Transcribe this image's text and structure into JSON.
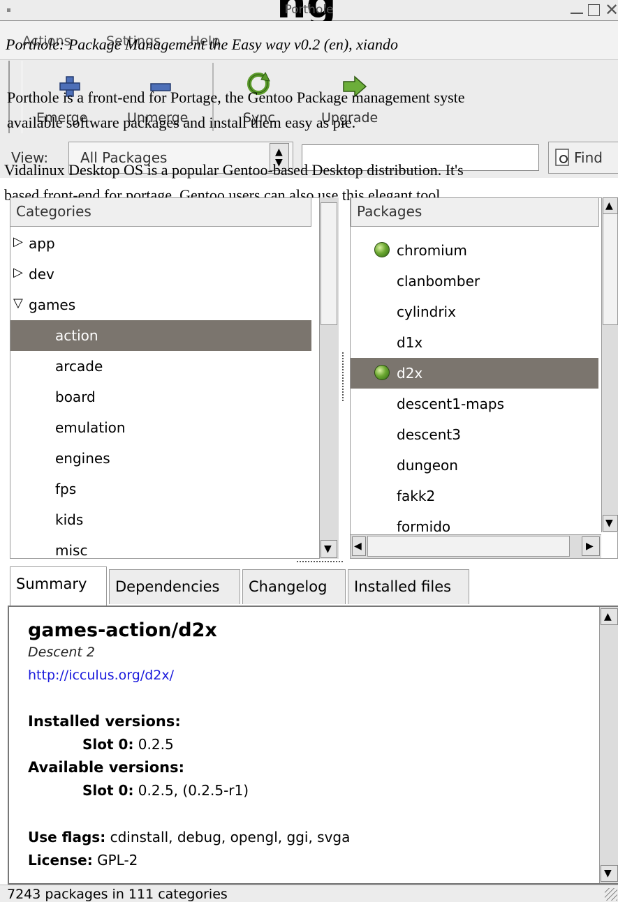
{
  "window": {
    "title": "Porthole",
    "heading_fragment": "ng "
  },
  "caption": "Porthole: Package Management the Easy way v0.2 (en), xiando",
  "menu": [
    "Actions",
    "Settings",
    "Help"
  ],
  "toolbar": {
    "buttons": [
      {
        "label": "Emerge",
        "icon": "plus-icon"
      },
      {
        "label": "Unmerge",
        "icon": "minus-icon"
      },
      {
        "label": "Sync",
        "icon": "sync-icon"
      },
      {
        "label": "Upgrade",
        "icon": "arrow-right-icon"
      }
    ]
  },
  "intro": {
    "line1": "Porthole is a front-end for Portage, the Gentoo Package management syste",
    "line2": "available software packages and install them easy as pie."
  },
  "view": {
    "label": "View:",
    "selected": "All Packages",
    "search_value": "",
    "find_label": "Find"
  },
  "distro": {
    "line1": "Vidalinux Desktop OS is a popular Gentoo-based Desktop distribution. It's",
    "line2": "based front-end for portage. Gentoo users can also use this elegant tool."
  },
  "categories": {
    "header": "Categories",
    "items": [
      {
        "label": "app",
        "indent": 0,
        "expander": "▷"
      },
      {
        "label": "dev",
        "indent": 0,
        "expander": "▷"
      },
      {
        "label": "games",
        "indent": 0,
        "expander": "▽"
      },
      {
        "label": "action",
        "indent": 1,
        "expander": ""
      },
      {
        "label": "arcade",
        "indent": 1,
        "expander": ""
      },
      {
        "label": "board",
        "indent": 1,
        "expander": ""
      },
      {
        "label": "emulation",
        "indent": 1,
        "expander": ""
      },
      {
        "label": "engines",
        "indent": 1,
        "expander": ""
      },
      {
        "label": "fps",
        "indent": 1,
        "expander": ""
      },
      {
        "label": "kids",
        "indent": 1,
        "expander": ""
      },
      {
        "label": "misc",
        "indent": 1,
        "expander": ""
      }
    ],
    "selected": "action"
  },
  "packages": {
    "header": "Packages",
    "items": [
      {
        "name": "chromium",
        "installed": true
      },
      {
        "name": "clanbomber",
        "installed": false
      },
      {
        "name": "cylindrix",
        "installed": false
      },
      {
        "name": "d1x",
        "installed": false
      },
      {
        "name": "d2x",
        "installed": true
      },
      {
        "name": "descent1-maps",
        "installed": false
      },
      {
        "name": "descent3",
        "installed": false
      },
      {
        "name": "dungeon",
        "installed": false
      },
      {
        "name": "fakk2",
        "installed": false
      },
      {
        "name": "formido",
        "installed": false
      }
    ],
    "selected": "d2x"
  },
  "tabs": [
    "Summary",
    "Dependencies",
    "Changelog",
    "Installed files"
  ],
  "active_tab": "Summary",
  "summary": {
    "name": "games-action/d2x",
    "description": "Descent 2",
    "homepage": "http://icculus.org/d2x/",
    "installed_label": "Installed versions:",
    "installed_slot_label": "Slot 0:",
    "installed_slot_value": "0.2.5",
    "available_label": "Available versions:",
    "available_slot_label": "Slot 0:",
    "available_slot_value": "0.2.5, (0.2.5-r1)",
    "use_flags_label": "Use flags:",
    "use_flags_value": "cdinstall, debug, opengl, ggi, svga",
    "license_label": "License:",
    "license_value": "GPL-2"
  },
  "status": "7243 packages in 111 categories",
  "colors": {
    "selection": "#7b756e",
    "link": "#1a1adc",
    "installed_dot": "#6ca832"
  }
}
